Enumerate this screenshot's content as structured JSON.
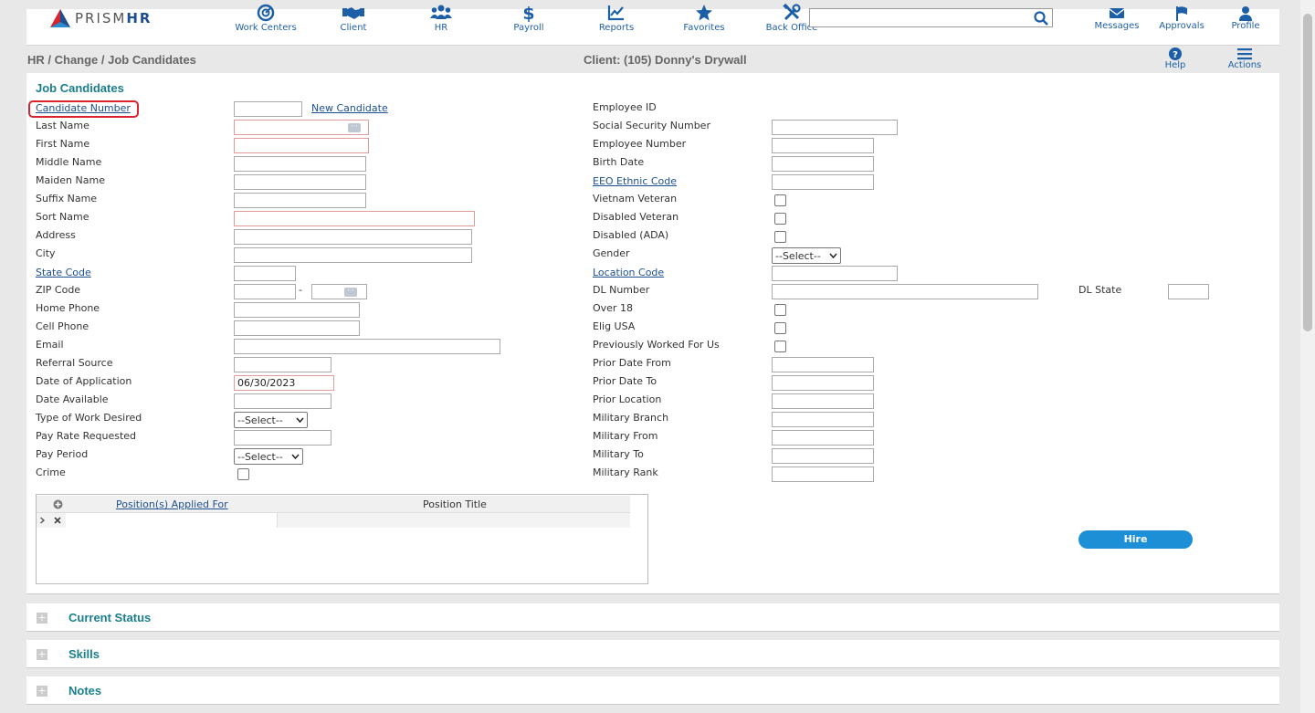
{
  "header": {
    "logo_text_light": "PRISM",
    "logo_text_bold": "HR",
    "nav": [
      {
        "label": "Work Centers",
        "icon": "work-centers-icon"
      },
      {
        "label": "Client",
        "icon": "handshake-icon"
      },
      {
        "label": "HR",
        "icon": "people-icon"
      },
      {
        "label": "Payroll",
        "icon": "dollar-icon"
      },
      {
        "label": "Reports",
        "icon": "chart-icon"
      },
      {
        "label": "Favorites",
        "icon": "star-icon"
      },
      {
        "label": "Back Office",
        "icon": "tools-icon"
      }
    ],
    "search_value": "",
    "right_nav": [
      {
        "label": "Messages",
        "icon": "envelope-icon"
      },
      {
        "label": "Approvals",
        "icon": "flag-icon"
      },
      {
        "label": "Profile",
        "icon": "user-icon"
      }
    ]
  },
  "subheader": {
    "breadcrumb": "HR / Change / Job Candidates",
    "client": "Client: (105) Donny's Drywall",
    "help_label": "Help",
    "actions_label": "Actions"
  },
  "form": {
    "title": "Job Candidates",
    "new_candidate": "New Candidate",
    "left": {
      "candidate_number": "Candidate Number",
      "last_name": "Last Name",
      "first_name": "First Name",
      "middle_name": "Middle Name",
      "maiden_name": "Maiden Name",
      "suffix_name": "Suffix Name",
      "sort_name": "Sort Name",
      "address": "Address",
      "city": "City",
      "state_code": "State Code",
      "zip_code": "ZIP Code",
      "zip_sep": "-",
      "home_phone": "Home Phone",
      "cell_phone": "Cell Phone",
      "email": "Email",
      "referral_source": "Referral Source",
      "date_of_application": "Date of Application",
      "date_of_application_value": "06/30/2023",
      "date_available": "Date Available",
      "type_of_work": "Type of Work Desired",
      "type_of_work_value": "--Select--",
      "pay_rate": "Pay Rate Requested",
      "pay_period": "Pay Period",
      "pay_period_value": "--Select--",
      "crime": "Crime"
    },
    "right": {
      "employee_id": "Employee ID",
      "ssn": "Social Security Number",
      "employee_number": "Employee Number",
      "birth_date": "Birth Date",
      "eeo": "EEO Ethnic Code",
      "vietnam": "Vietnam Veteran",
      "disabled_veteran": "Disabled Veteran",
      "disabled_ada": "Disabled (ADA)",
      "gender": "Gender",
      "gender_value": "--Select--",
      "location_code": "Location Code",
      "dl_number": "DL Number",
      "dl_state": "DL State",
      "over18": "Over 18",
      "elig_usa": "Elig USA",
      "prev_worked": "Previously Worked For Us",
      "prior_from": "Prior Date From",
      "prior_to": "Prior Date To",
      "prior_location": "Prior Location",
      "mil_branch": "Military Branch",
      "mil_from": "Military From",
      "mil_to": "Military To",
      "mil_rank": "Military Rank"
    },
    "grid": {
      "col1": "Position(s) Applied For",
      "col2": "Position Title"
    },
    "hire": "Hire"
  },
  "sections": [
    "Current Status",
    "Skills",
    "Notes"
  ]
}
